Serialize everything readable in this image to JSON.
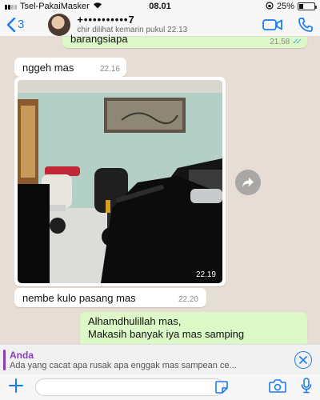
{
  "status_bar": {
    "carrier": "Tsel-PakaiMasker",
    "time": "08.01",
    "battery": "25%",
    "battery_level": 0.25
  },
  "header": {
    "back_count": "3",
    "contact_name": "+••••••••••7",
    "last_seen": "chir dilihat kemarin pukul 22.13"
  },
  "messages": [
    {
      "direction": "outgoing",
      "text": "barangsiapa",
      "time": "21.58",
      "status": "read"
    },
    {
      "direction": "incoming",
      "text": "nggeh mas",
      "time": "22.16"
    },
    {
      "direction": "incoming",
      "type": "image",
      "time": "22.19"
    },
    {
      "direction": "incoming",
      "text": "nembe kulo pasang mas",
      "time": "22.20"
    },
    {
      "direction": "outgoing",
      "line1": "Alhamdhulillah mas,",
      "line2": "Makasih banyak iya mas samping"
    }
  ],
  "reply": {
    "author": "Anda",
    "text": "Ada yang cacat apa rusak apa enggak mas sampean ce..."
  },
  "composer": {
    "value": "",
    "placeholder": ""
  },
  "colors": {
    "accent": "#1a7cf0",
    "outgoing_bubble": "#dcf8c6",
    "incoming_bubble": "#ffffff",
    "reply_author": "#8b3cb7",
    "chat_background": "#e6ddd4"
  },
  "icons": [
    "back-chevron-icon",
    "video-call-icon",
    "phone-icon",
    "read-ticks-icon",
    "share-icon",
    "close-icon",
    "plus-icon",
    "sticker-icon",
    "camera-icon",
    "mic-icon"
  ]
}
